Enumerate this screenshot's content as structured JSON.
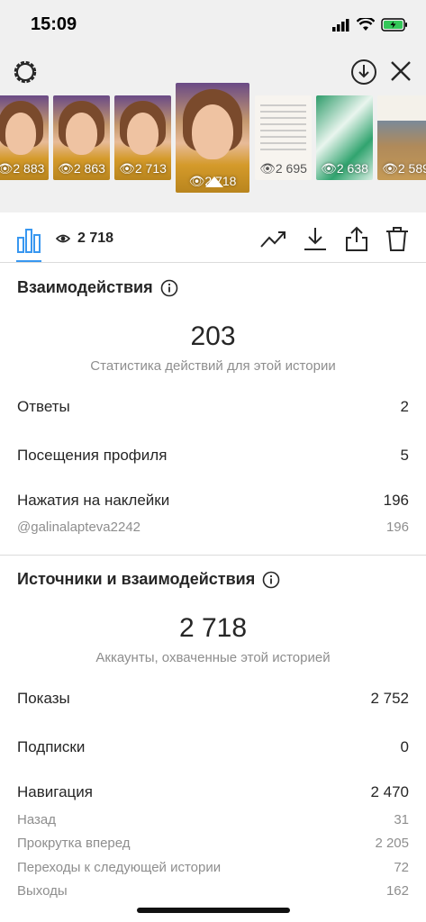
{
  "status_bar": {
    "time": "15:09"
  },
  "thumbnails": [
    {
      "count": "2 883",
      "kind": "face"
    },
    {
      "count": "2 863",
      "kind": "face"
    },
    {
      "count": "2 713",
      "kind": "face"
    },
    {
      "count": "2 718",
      "kind": "face",
      "selected": true
    },
    {
      "count": "2 695",
      "kind": "text"
    },
    {
      "count": "2 638",
      "kind": "green"
    },
    {
      "count": "2 589",
      "kind": "food"
    }
  ],
  "toolbar": {
    "views": "2 718"
  },
  "interactions": {
    "title": "Взаимодействия",
    "total": "203",
    "subtitle": "Статистика действий для этой истории",
    "rows": [
      {
        "label": "Ответы",
        "value": "2"
      },
      {
        "label": "Посещения профиля",
        "value": "5"
      },
      {
        "label": "Нажатия на наклейки",
        "value": "196"
      }
    ],
    "sticker_sub": {
      "label": "@galinalapteva2242",
      "value": "196"
    }
  },
  "sources": {
    "title": "Источники и взаимодействия",
    "total": "2 718",
    "subtitle": "Аккаунты, охваченные этой историей",
    "rows": [
      {
        "label": "Показы",
        "value": "2 752"
      },
      {
        "label": "Подписки",
        "value": "0"
      },
      {
        "label": "Навигация",
        "value": "2 470"
      }
    ],
    "nav_sub": [
      {
        "label": "Назад",
        "value": "31"
      },
      {
        "label": "Прокрутка вперед",
        "value": "2 205"
      },
      {
        "label": "Переходы к следующей истории",
        "value": "72"
      },
      {
        "label": "Выходы",
        "value": "162"
      }
    ]
  },
  "colors": {
    "accent": "#3897f0",
    "text": "#262626",
    "muted": "#8e8e8e",
    "top_bg": "#f0f0f0"
  },
  "icons": [
    "gear-icon",
    "download-circle-icon",
    "close-icon",
    "bar-chart-icon",
    "eye-icon",
    "trend-icon",
    "download-icon",
    "share-icon",
    "trash-icon",
    "info-icon"
  ]
}
